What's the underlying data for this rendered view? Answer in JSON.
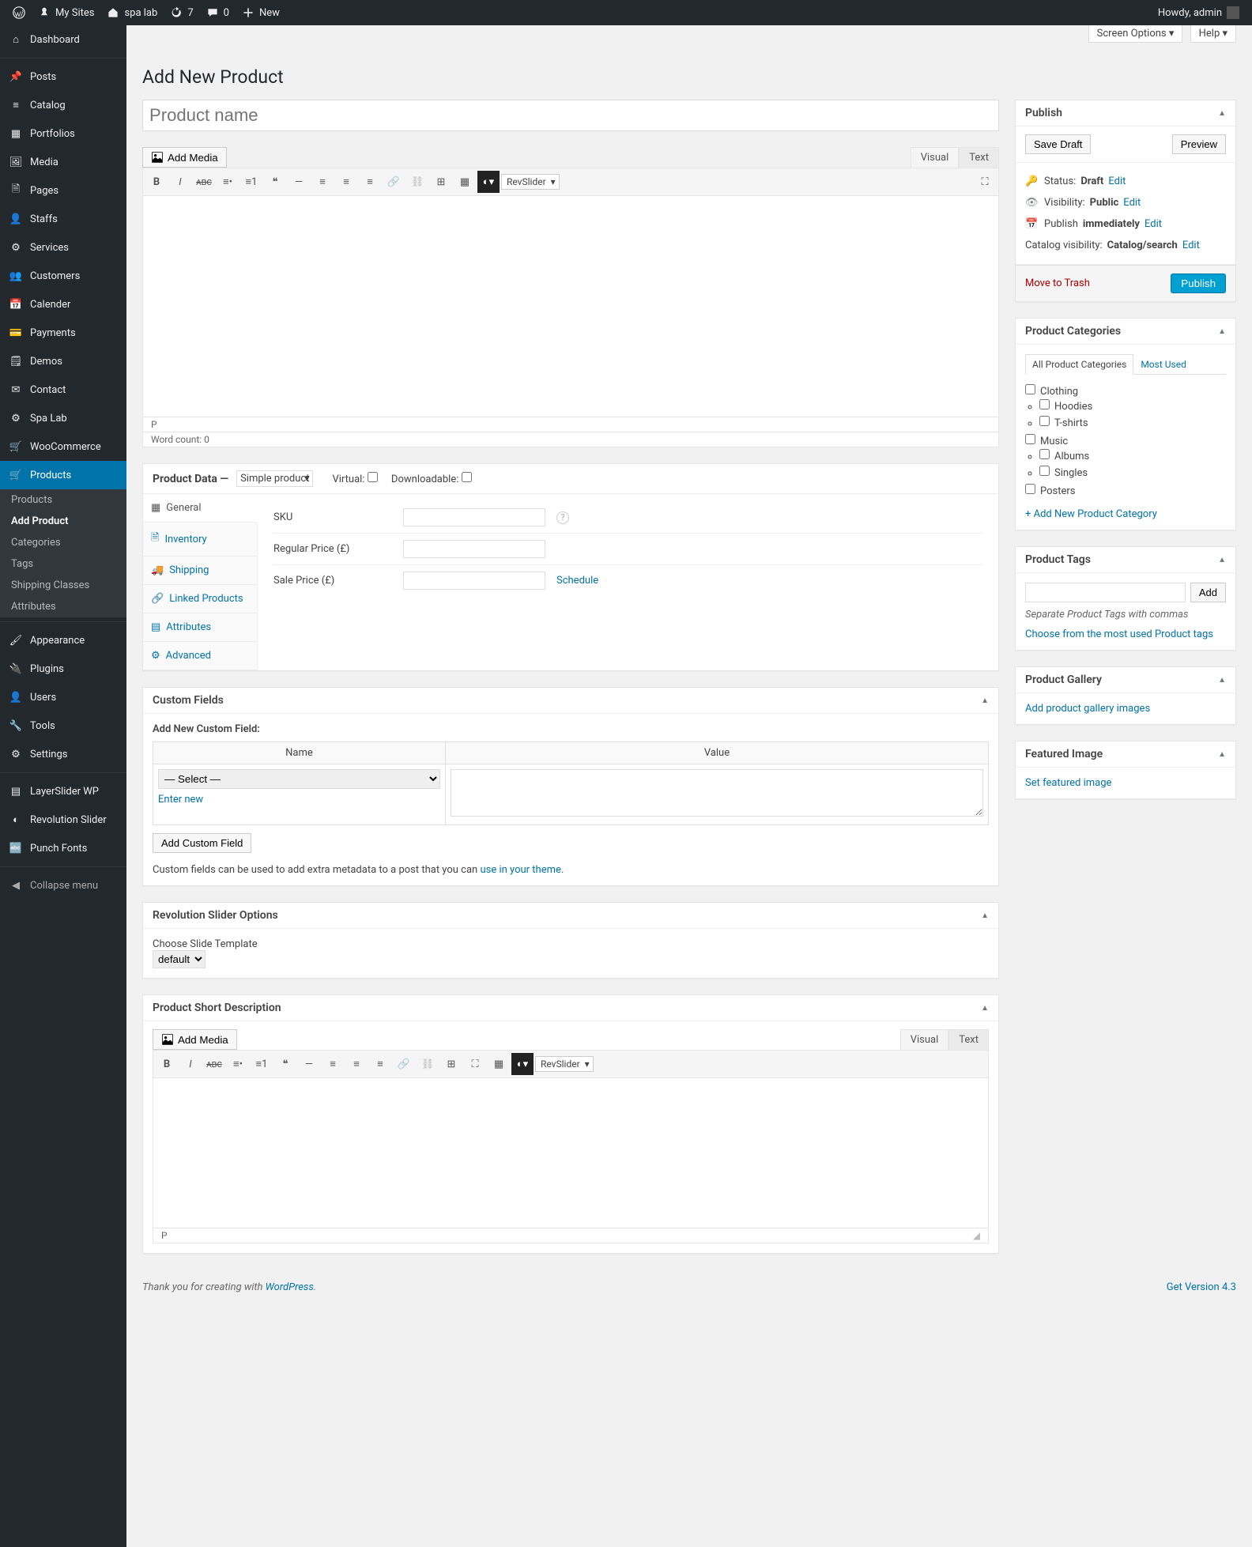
{
  "adminbar": {
    "mysites": "My Sites",
    "sitename": "spa lab",
    "updates": "7",
    "comments": "0",
    "new": "New",
    "howdy": "Howdy, admin"
  },
  "sidebar": {
    "items": [
      {
        "label": "Dashboard",
        "icon": "dashboard"
      },
      {
        "label": "Posts",
        "icon": "pin"
      },
      {
        "label": "Catalog",
        "icon": "list"
      },
      {
        "label": "Portfolios",
        "icon": "grid"
      },
      {
        "label": "Media",
        "icon": "media"
      },
      {
        "label": "Pages",
        "icon": "page"
      },
      {
        "label": "Staffs",
        "icon": "user"
      },
      {
        "label": "Services",
        "icon": "gear"
      },
      {
        "label": "Customers",
        "icon": "users"
      },
      {
        "label": "Calender",
        "icon": "calendar"
      },
      {
        "label": "Payments",
        "icon": "card"
      },
      {
        "label": "Demos",
        "icon": "text"
      },
      {
        "label": "Contact",
        "icon": "mail"
      },
      {
        "label": "Spa Lab",
        "icon": "gear"
      },
      {
        "label": "WooCommerce",
        "icon": "cart"
      },
      {
        "label": "Products",
        "icon": "cart",
        "current": true
      }
    ],
    "submenu": [
      {
        "label": "Products"
      },
      {
        "label": "Add Product",
        "current": true
      },
      {
        "label": "Categories"
      },
      {
        "label": "Tags"
      },
      {
        "label": "Shipping Classes"
      },
      {
        "label": "Attributes"
      }
    ],
    "items2": [
      {
        "label": "Appearance",
        "icon": "brush"
      },
      {
        "label": "Plugins",
        "icon": "plug"
      },
      {
        "label": "Users",
        "icon": "user"
      },
      {
        "label": "Tools",
        "icon": "wrench"
      },
      {
        "label": "Settings",
        "icon": "settings"
      },
      {
        "label": "LayerSlider WP",
        "icon": "layers"
      },
      {
        "label": "Revolution Slider",
        "icon": "rev"
      },
      {
        "label": "Punch Fonts",
        "icon": "font"
      }
    ],
    "collapse": "Collapse menu"
  },
  "screen": {
    "options": "Screen Options",
    "help": "Help"
  },
  "page": {
    "title": "Add New Product",
    "title_placeholder": "Product name"
  },
  "editor": {
    "add_media": "Add Media",
    "tab_visual": "Visual",
    "tab_text": "Text",
    "rev_slider": "RevSlider",
    "path": "P",
    "wordcount": "Word count: 0"
  },
  "product_data": {
    "header": "Product Data",
    "type": "Simple product",
    "virtual_label": "Virtual:",
    "downloadable_label": "Downloadable:",
    "tabs": {
      "general": "General",
      "inventory": "Inventory",
      "shipping": "Shipping",
      "linked": "Linked Products",
      "attributes": "Attributes",
      "advanced": "Advanced"
    },
    "fields": {
      "sku": "SKU",
      "regular_price": "Regular Price (£)",
      "sale_price": "Sale Price (£)",
      "schedule": "Schedule"
    }
  },
  "custom_fields": {
    "title": "Custom Fields",
    "add_new": "Add New Custom Field:",
    "col_name": "Name",
    "col_value": "Value",
    "select_placeholder": "— Select —",
    "enter_new": "Enter new",
    "add_btn": "Add Custom Field",
    "help1": "Custom fields can be used to add extra metadata to a post that you can ",
    "help_link": "use in your theme"
  },
  "revslider": {
    "title": "Revolution Slider Options",
    "choose": "Choose Slide Template",
    "default": "default"
  },
  "short_desc": {
    "title": "Product Short Description"
  },
  "publish": {
    "title": "Publish",
    "save_draft": "Save Draft",
    "preview": "Preview",
    "status_label": "Status:",
    "status_value": "Draft",
    "visibility_label": "Visibility:",
    "visibility_value": "Public",
    "publish_label": "Publish",
    "publish_value": "immediately",
    "catalog_label": "Catalog visibility:",
    "catalog_value": "Catalog/search",
    "edit": "Edit",
    "trash": "Move to Trash",
    "publish_btn": "Publish"
  },
  "categories": {
    "title": "Product Categories",
    "tab_all": "All Product Categories",
    "tab_most": "Most Used",
    "items": [
      "Clothing",
      "Hoodies",
      "T-shirts",
      "Music",
      "Albums",
      "Singles",
      "Posters"
    ],
    "add_new": "+ Add New Product Category"
  },
  "tags": {
    "title": "Product Tags",
    "add": "Add",
    "help": "Separate Product Tags with commas",
    "choose": "Choose from the most used Product tags"
  },
  "gallery": {
    "title": "Product Gallery",
    "add": "Add product gallery images"
  },
  "featured": {
    "title": "Featured Image",
    "set": "Set featured image"
  },
  "footer": {
    "thank": "Thank you for creating with ",
    "wp": "WordPress",
    "version": "Get Version 4.3"
  }
}
